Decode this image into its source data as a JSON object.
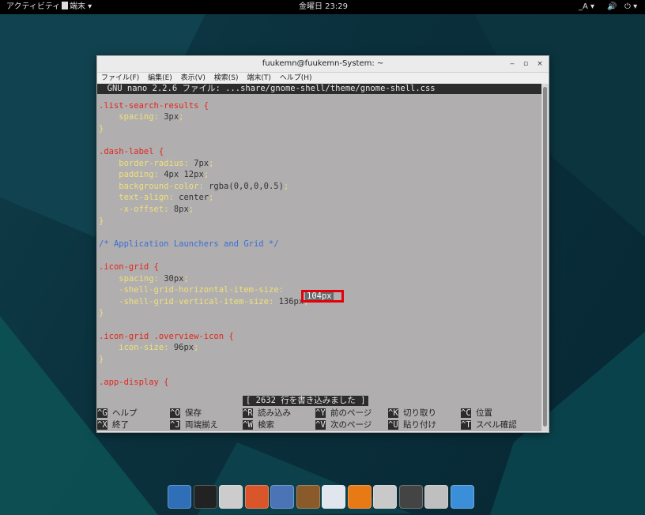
{
  "topbar": {
    "activities": "アクティビティ",
    "app_menu": "端末 ▾",
    "clock": "金曜日 23:29",
    "input_method": "_A ▾",
    "volume": "🔊",
    "power": "⏻ ▾"
  },
  "window": {
    "title": "fuukemn@fuukemn-System: ~",
    "minimize": "‒",
    "maximize": "▫",
    "close": "×",
    "menu": [
      "ファイル(F)",
      "編集(E)",
      "表示(V)",
      "検索(S)",
      "端末(T)",
      "ヘルプ(H)"
    ]
  },
  "nano": {
    "header": "  GNU nano 2.2.6 ファイル: ...share/gnome-shell/theme/gnome-shell.css",
    "lines": [
      {
        "sel": ".list-search-results {"
      },
      {
        "prop": "    spacing",
        "val": " 3px",
        "end": ";"
      },
      {
        "brace": "}"
      },
      {
        "sel": ".dash-label {"
      },
      {
        "prop": "    border-radius",
        "val": " 7px",
        "end": ";"
      },
      {
        "prop": "    padding",
        "val": " 4px 12px",
        "end": ";"
      },
      {
        "prop": "    background-color",
        "val": " rgba(0,0,0,0.5)",
        "end": ";"
      },
      {
        "prop": "    text-align",
        "val": " center",
        "end": ";"
      },
      {
        "prop": "    -x-offset",
        "val": " 8px",
        "end": ";"
      },
      {
        "brace": "}"
      },
      {
        "comment": "/* Application Launchers and Grid */"
      },
      {
        "sel": ".icon-grid {"
      },
      {
        "prop": "    spacing",
        "val": " 30px",
        "end": ";"
      },
      {
        "prop": "    -shell-grid-horizontal-item-size",
        "val": "",
        "end": ""
      },
      {
        "prop": "    -shell-grid-vertical-item-size",
        "val": " 136px",
        "end": ";"
      },
      {
        "brace": "}"
      },
      {
        "sel": ".icon-grid .overview-icon {"
      },
      {
        "prop": "    icon-size",
        "val": " 96px",
        "end": ";"
      },
      {
        "brace": "}"
      },
      {
        "sel": ".app-display {"
      }
    ],
    "highlight_value": "104px",
    "status": "[ 2632 行を書き込みました ]",
    "shortcuts": [
      {
        "key": "^G",
        "label": "ヘルプ"
      },
      {
        "key": "^O",
        "label": "保存"
      },
      {
        "key": "^R",
        "label": "読み込み"
      },
      {
        "key": "^Y",
        "label": "前のページ"
      },
      {
        "key": "^K",
        "label": "切り取り"
      },
      {
        "key": "^C",
        "label": "位置"
      },
      {
        "key": "^X",
        "label": "終了"
      },
      {
        "key": "^J",
        "label": "両端揃え"
      },
      {
        "key": "^W",
        "label": "検索"
      },
      {
        "key": "^V",
        "label": "次のページ"
      },
      {
        "key": "^U",
        "label": "貼り付け"
      },
      {
        "key": "^T",
        "label": "スペル確認"
      }
    ]
  },
  "dock": {
    "icons": [
      "anchor-icon",
      "terminal-icon",
      "files-icon",
      "firefox-icon",
      "image-viewer-icon",
      "music-icon",
      "messaging-icon",
      "vlc-icon",
      "settings-icon",
      "disk-icon",
      "trash-icon",
      "desktop-icon"
    ]
  }
}
